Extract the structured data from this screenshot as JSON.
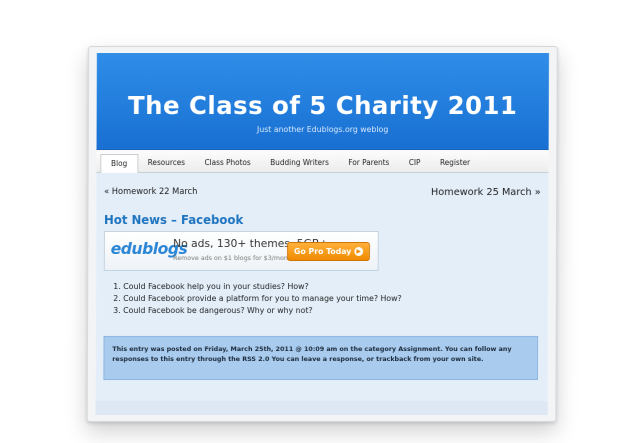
{
  "site": {
    "title": "The Class of 5 Charity 2011",
    "tagline": "Just another Edublogs.org weblog"
  },
  "nav": {
    "items": [
      {
        "label": "Blog",
        "active": true
      },
      {
        "label": "Resources"
      },
      {
        "label": "Class Photos"
      },
      {
        "label": "Budding Writers"
      },
      {
        "label": "For Parents"
      },
      {
        "label": "CIP"
      },
      {
        "label": "Register"
      }
    ]
  },
  "postnav": {
    "prev": "« Homework 22 March",
    "next": "Homework 25 March »"
  },
  "post": {
    "title": "Hot News – Facebook",
    "questions": [
      "Could Facebook help you in your studies? How?",
      "Could Facebook provide a platform for you to manage your time? How?",
      "Could Facebook be dangerous? Why or why not?"
    ],
    "entry_meta": "This entry was posted on Friday, March 25th, 2011 @ 10:09 am on the category Assignment. You can follow any responses to this entry through the RSS 2.0 You can leave a response, or trackback from your own site."
  },
  "ad": {
    "logo": "edublogs",
    "headline": "No ads, 130+ themes, 5GB+",
    "subline": "Remove ads on $1 blogs for $3/month!",
    "cta": "Go Pro Today"
  },
  "colors": {
    "header": "#1f7ddc",
    "content_bg": "#e3eef9",
    "entry_box": "#a9cbee",
    "cta": "#f39200"
  }
}
